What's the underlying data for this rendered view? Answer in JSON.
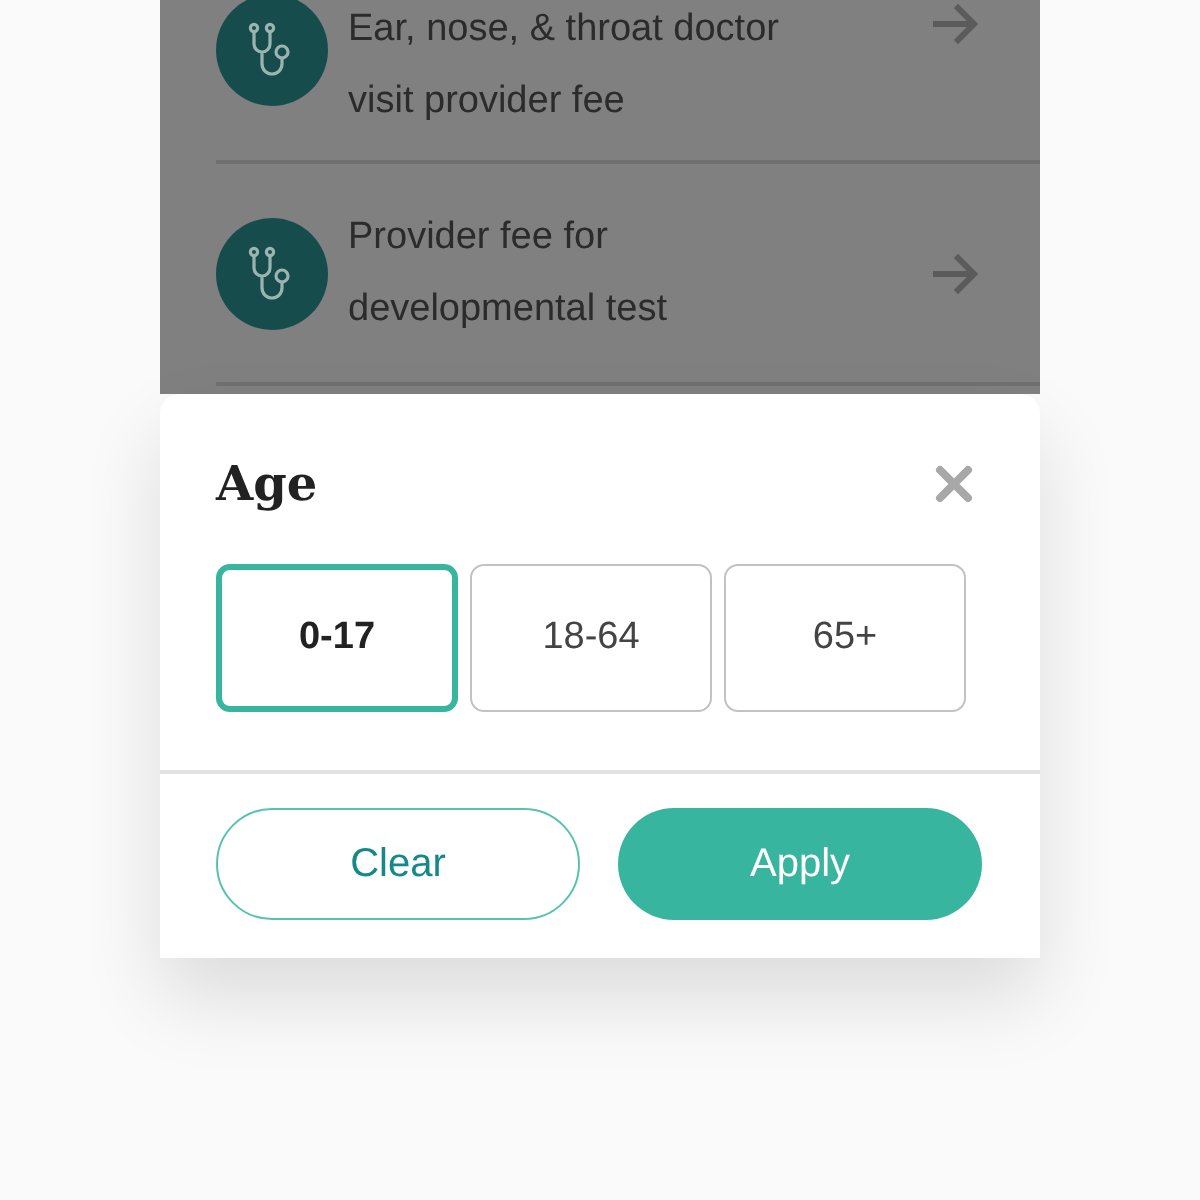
{
  "list": [
    {
      "lines": [
        "Ear, nose, & throat doctor",
        "visit provider fee"
      ]
    },
    {
      "lines": [
        "Provider fee for",
        "developmental test"
      ]
    }
  ],
  "modal": {
    "title": "Age",
    "options": [
      {
        "label": "0-17",
        "selected": true
      },
      {
        "label": "18-64",
        "selected": false
      },
      {
        "label": "65+",
        "selected": false
      }
    ],
    "buttons": [
      {
        "label": "Clear",
        "kind": "secondary"
      },
      {
        "label": "Apply",
        "kind": "primary"
      }
    ]
  }
}
